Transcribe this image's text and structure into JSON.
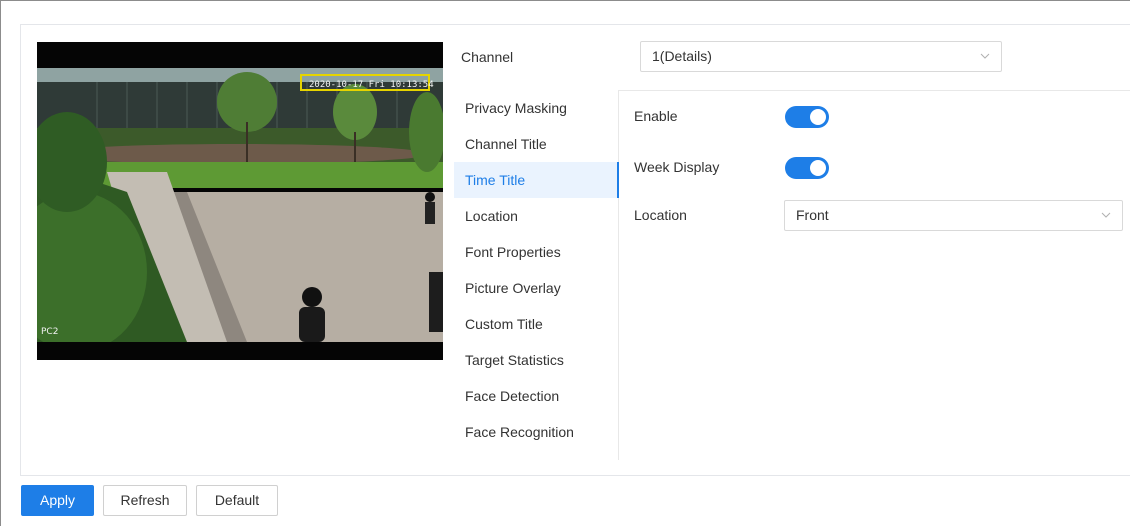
{
  "channel": {
    "label": "Channel",
    "value": "1(Details)"
  },
  "video": {
    "osd_time": "2020-10-17 Fri  10:13:54",
    "osd_channel": "PC2"
  },
  "menu": [
    {
      "label": "Privacy Masking",
      "active": false
    },
    {
      "label": "Channel Title",
      "active": false
    },
    {
      "label": "Time Title",
      "active": true
    },
    {
      "label": "Location",
      "active": false
    },
    {
      "label": "Font Properties",
      "active": false
    },
    {
      "label": "Picture Overlay",
      "active": false
    },
    {
      "label": "Custom Title",
      "active": false
    },
    {
      "label": "Target Statistics",
      "active": false
    },
    {
      "label": "Face Detection",
      "active": false
    },
    {
      "label": "Face Recognition",
      "active": false
    }
  ],
  "form": {
    "enable_label": "Enable",
    "enable_on": true,
    "week_display_label": "Week Display",
    "week_display_on": true,
    "location_label": "Location",
    "location_value": "Front"
  },
  "buttons": {
    "apply": "Apply",
    "refresh": "Refresh",
    "default": "Default"
  },
  "colors": {
    "accent": "#1e7ee7",
    "menu_active_bg": "#eaf3fe",
    "osd_box": "#e6d400"
  },
  "icons": {
    "select_arrow": "chevron-down-icon"
  }
}
